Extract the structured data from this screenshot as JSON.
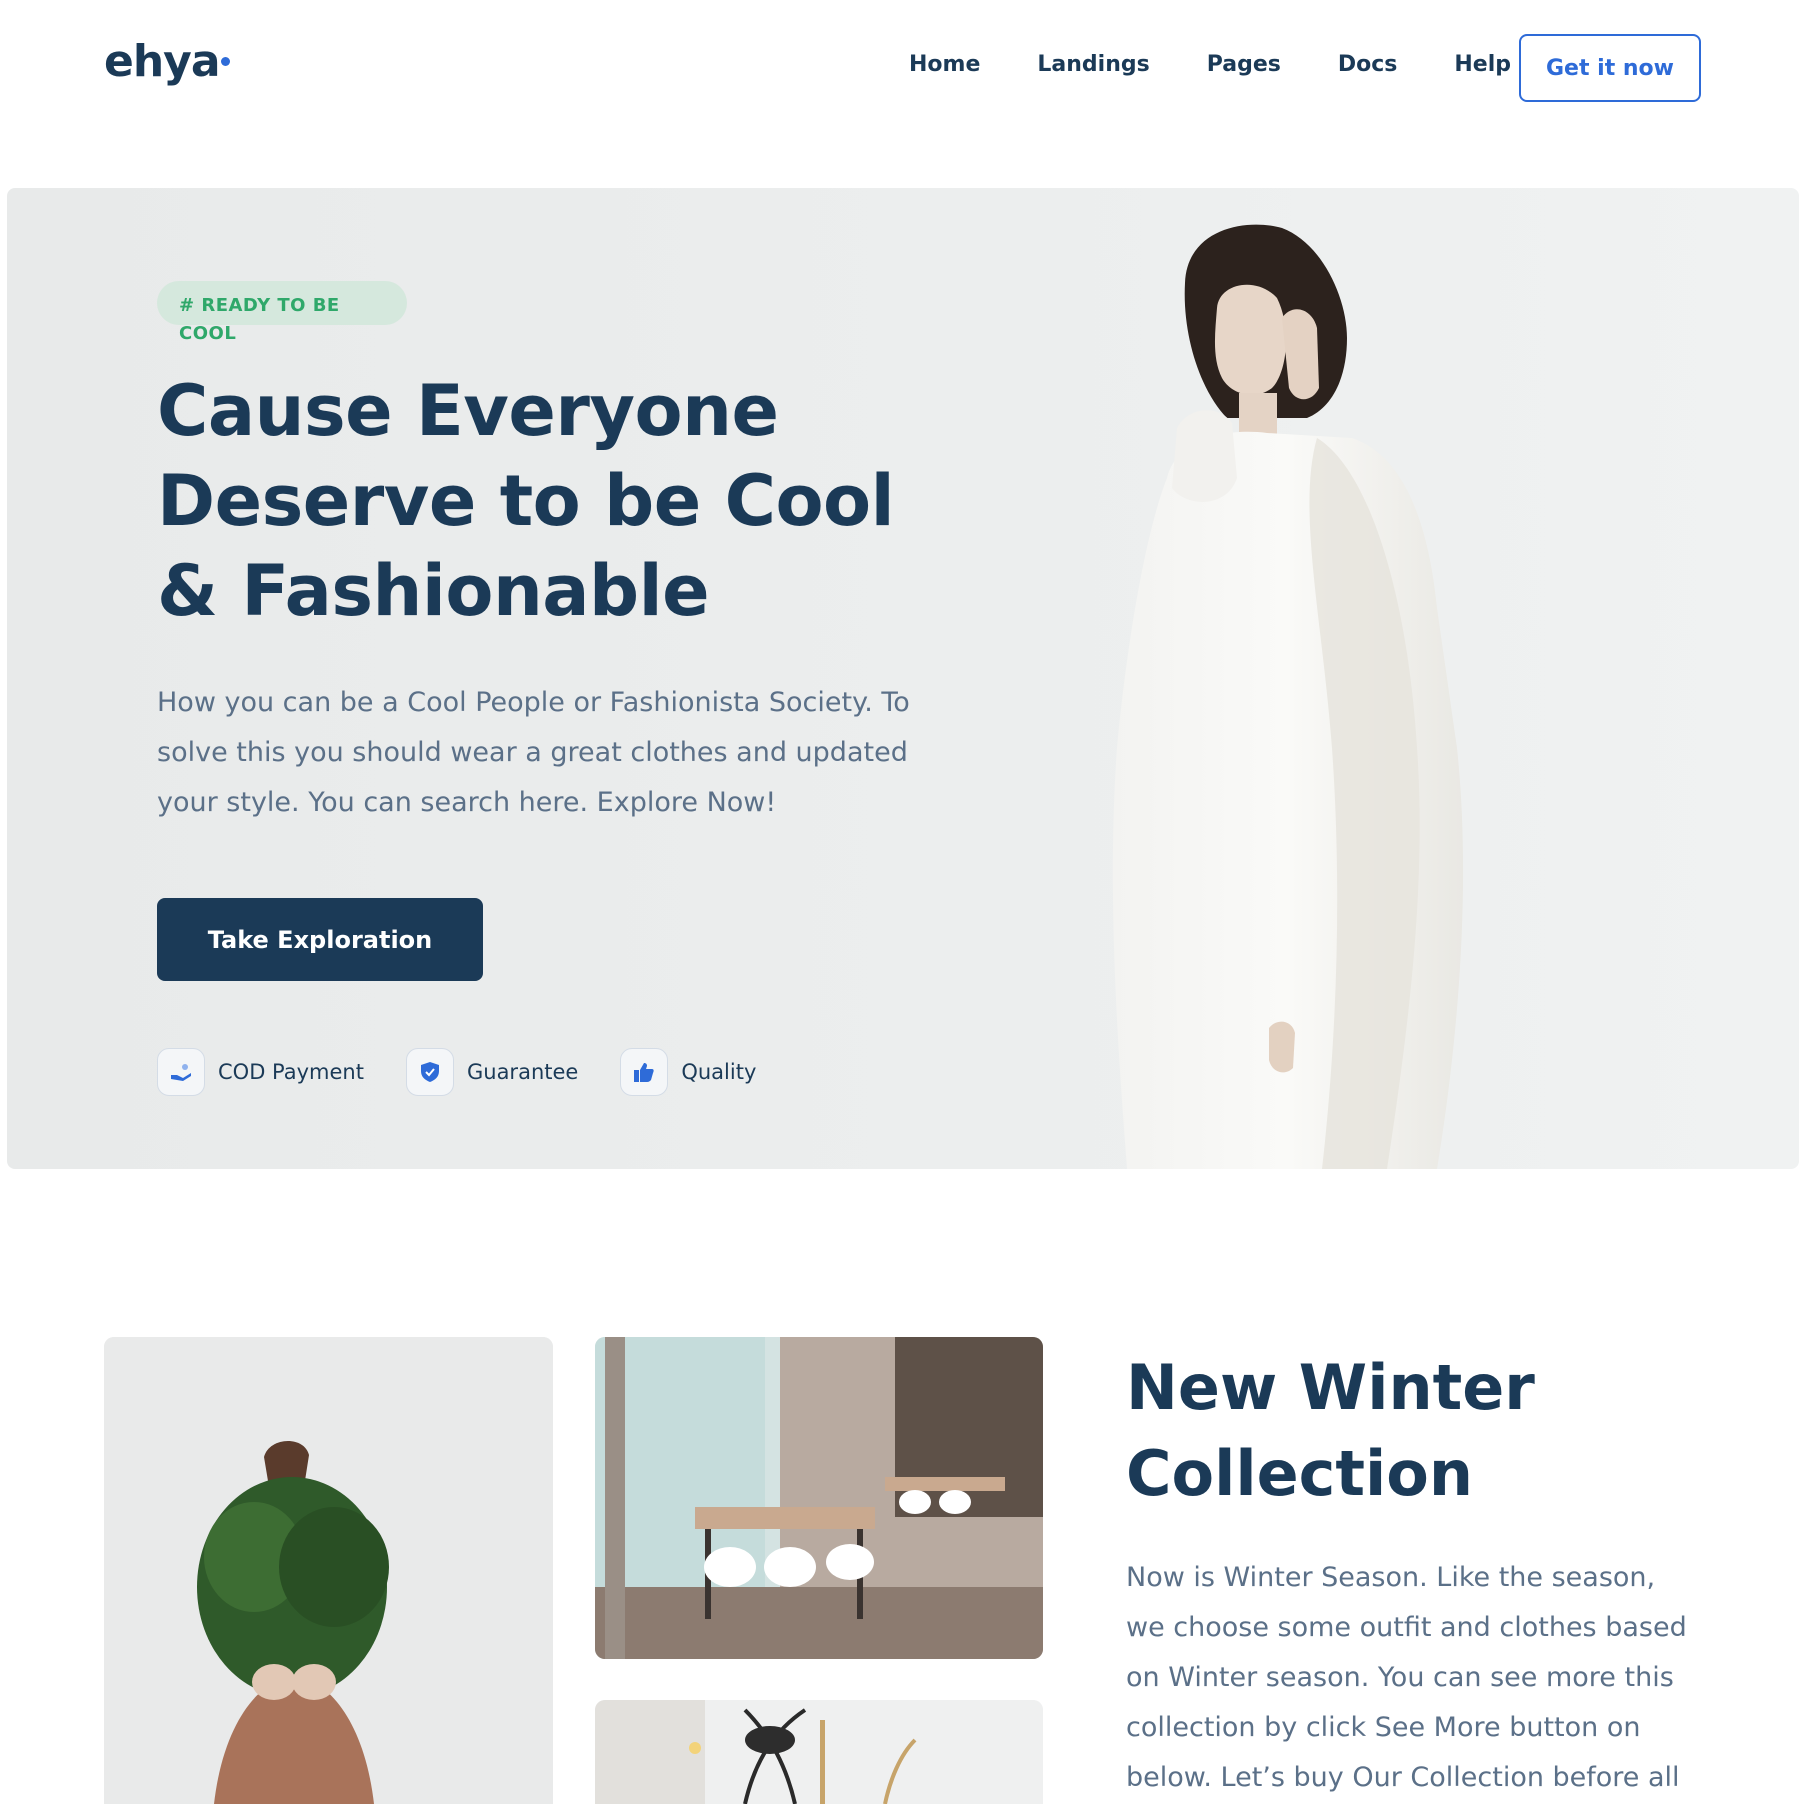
{
  "brand": {
    "name": "ehya",
    "accent": "#2e6bd8",
    "primary": "#1b3a57",
    "success": "#2fa86a"
  },
  "nav": {
    "links": [
      "Home",
      "Landings",
      "Pages",
      "Docs",
      "Help"
    ],
    "cta": "Get it now"
  },
  "hero": {
    "badge": "# READY TO BE COOL",
    "title": "Cause Everyone Deserve to be Cool & Fashionable",
    "description": "How you can be a Cool People or Fashionista Society. To solve this you should wear a great clothes and updated your style. You can search here. Explore Now!",
    "button": "Take Exploration",
    "features": [
      {
        "label": "COD Payment",
        "icon": "hand-payment-icon"
      },
      {
        "label": "Guarantee",
        "icon": "shield-check-icon"
      },
      {
        "label": "Quality",
        "icon": "thumbs-up-icon"
      }
    ]
  },
  "collection": {
    "title": "New Winter Collection",
    "description": "Now is Winter Season. Like the season, we choose some outfit and clothes based on Winter season. You can see more this collection by click See More button on below. Let’s buy Our Collection before all"
  }
}
